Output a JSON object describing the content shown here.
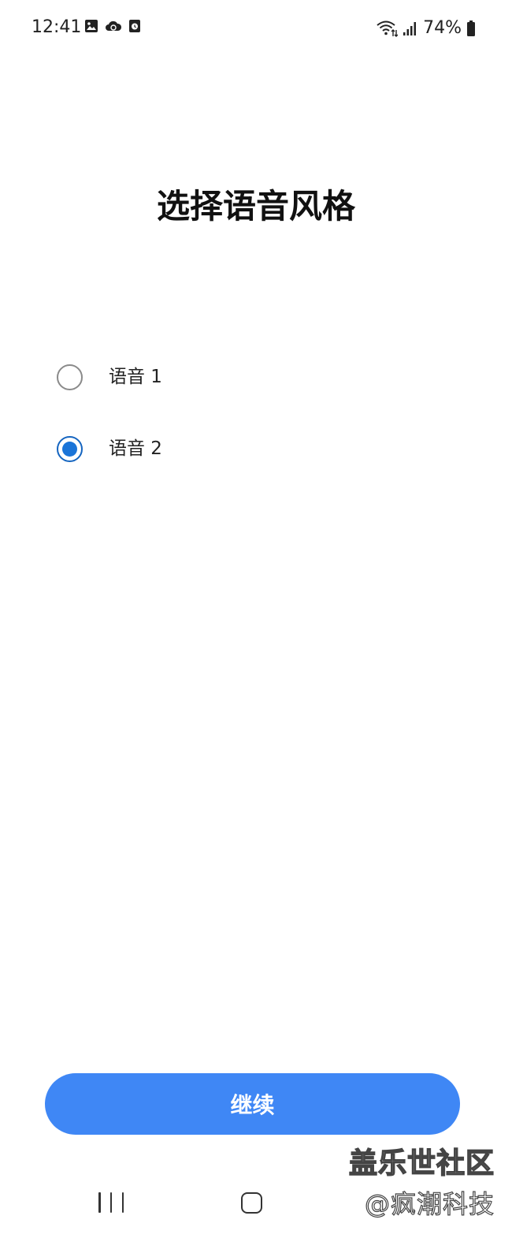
{
  "status_bar": {
    "time": "12:41",
    "left_icons": [
      "image-icon",
      "cloud-sync-icon",
      "alarm-card-icon"
    ],
    "right_icons": [
      "wifi-icon",
      "signal-icon",
      "battery-icon"
    ],
    "battery": "74%"
  },
  "page": {
    "title": "选择语音风格"
  },
  "options": [
    {
      "label": "语音 1",
      "checked": false
    },
    {
      "label": "语音 2",
      "checked": true
    }
  ],
  "button": {
    "continue_label": "继续"
  },
  "watermark": {
    "line1": "盖乐世社区",
    "line2": "@疯潮科技"
  },
  "colors": {
    "accent": "#3f87f5",
    "radio_checked": "#1a74d8"
  }
}
